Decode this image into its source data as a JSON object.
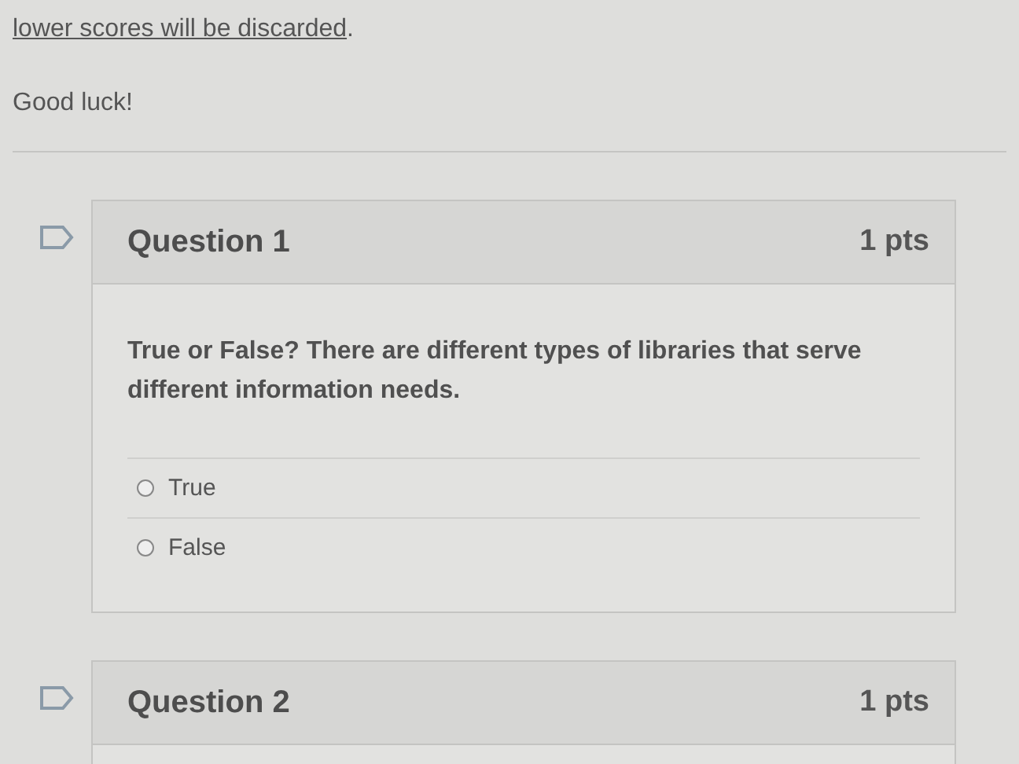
{
  "intro": {
    "link": "lower scores will be discarded",
    "after": "."
  },
  "closing": "Good luck!",
  "questions": [
    {
      "title": "Question 1",
      "points": "1 pts",
      "text": "True or False? There are different types of libraries that serve different information needs.",
      "answers": [
        {
          "label": "True",
          "selected": false
        },
        {
          "label": "False",
          "selected": false
        }
      ]
    },
    {
      "title": "Question 2",
      "points": "1 pts"
    }
  ]
}
